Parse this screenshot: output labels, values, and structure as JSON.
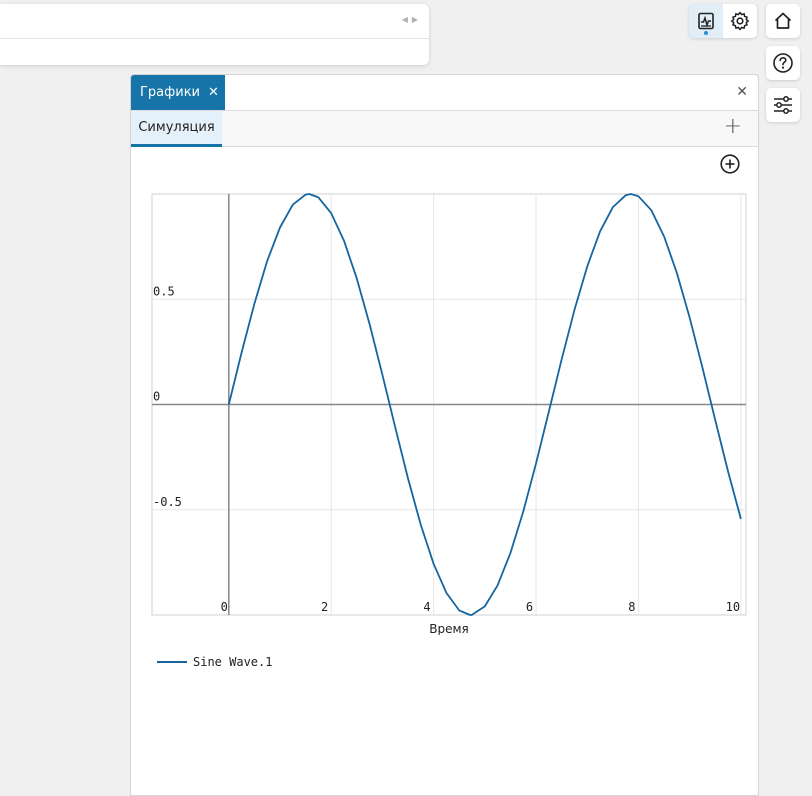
{
  "window": {
    "tab_label": "Графики",
    "subtab_label": "Симуляция"
  },
  "chart_data": {
    "type": "line",
    "xlabel": "Время",
    "xlim": [
      -1.5,
      10.1
    ],
    "ylim": [
      -1.0,
      1.0
    ],
    "x_ticks": [
      "0",
      "2",
      "4",
      "6",
      "8",
      "10"
    ],
    "y_ticks": [
      "0.5",
      "0",
      "-0.5"
    ],
    "x_tick_values": [
      0,
      2,
      4,
      6,
      8,
      10
    ],
    "y_tick_values": [
      0.5,
      0,
      -0.5
    ],
    "grid": true,
    "legend_position": "bottom-left",
    "series": [
      {
        "name": "Sine Wave.1",
        "color": "#1565a0",
        "x": [
          0,
          0.25,
          0.5,
          0.75,
          1,
          1.25,
          1.5,
          1.5708,
          1.75,
          2,
          2.25,
          2.5,
          2.75,
          3,
          3.25,
          3.5,
          3.75,
          4,
          4.25,
          4.5,
          4.7124,
          4.75,
          5,
          5.25,
          5.5,
          5.75,
          6,
          6.25,
          6.5,
          6.75,
          7,
          7.25,
          7.5,
          7.75,
          7.854,
          8,
          8.25,
          8.5,
          8.75,
          9,
          9.25,
          9.5,
          9.75,
          10
        ],
        "y": [
          0,
          0.247,
          0.479,
          0.682,
          0.841,
          0.949,
          0.997,
          1,
          0.984,
          0.909,
          0.778,
          0.598,
          0.382,
          0.141,
          -0.108,
          -0.351,
          -0.572,
          -0.757,
          -0.895,
          -0.978,
          -1,
          -0.999,
          -0.959,
          -0.859,
          -0.706,
          -0.508,
          -0.279,
          -0.033,
          0.215,
          0.45,
          0.657,
          0.823,
          0.938,
          0.994,
          1,
          0.989,
          0.923,
          0.798,
          0.624,
          0.412,
          0.174,
          -0.075,
          -0.319,
          -0.544
        ]
      }
    ]
  }
}
